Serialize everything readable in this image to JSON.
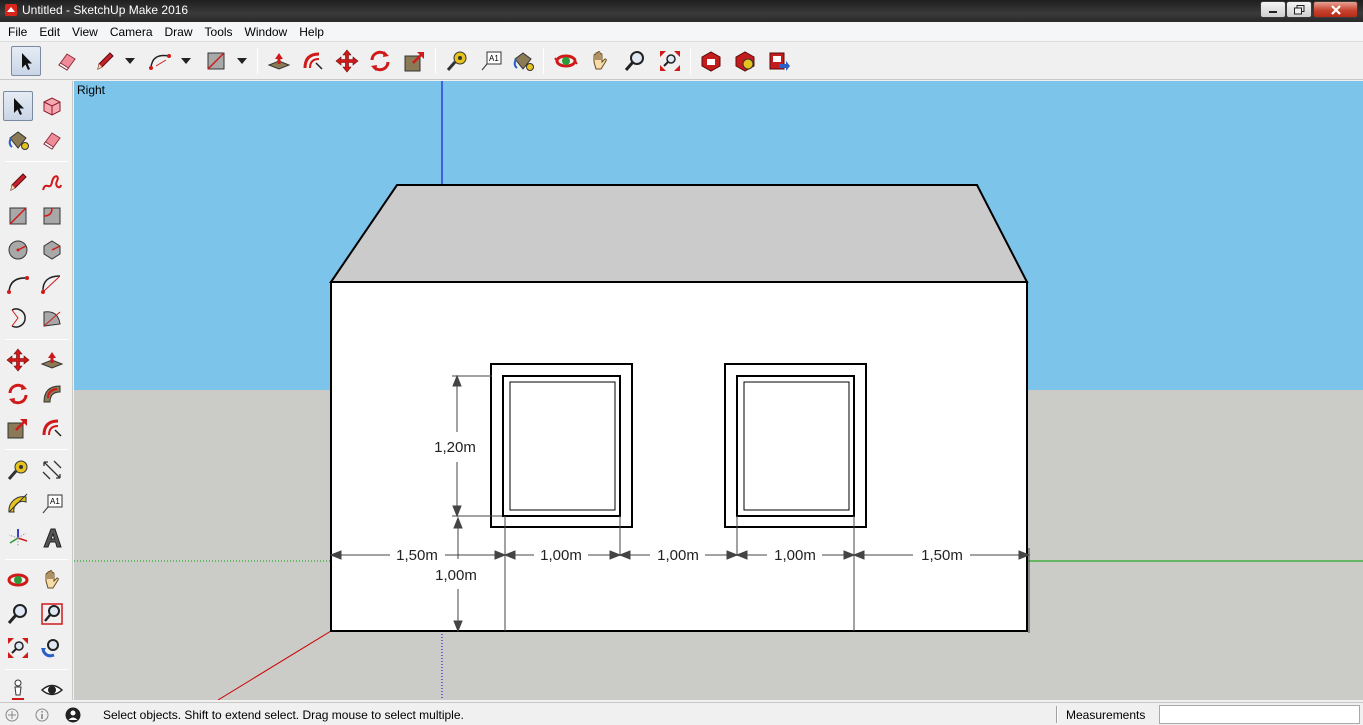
{
  "window": {
    "title": "Untitled - SketchUp Make 2016"
  },
  "menu": {
    "items": [
      "File",
      "Edit",
      "View",
      "Camera",
      "Draw",
      "Tools",
      "Window",
      "Help"
    ]
  },
  "toolbar": {
    "tools": [
      {
        "name": "select-tool",
        "icon": "arrow-icon"
      },
      {
        "name": "eraser-tool",
        "icon": "eraser-icon"
      },
      {
        "name": "line-tool",
        "icon": "pencil-icon"
      },
      {
        "name": "arc-tool",
        "icon": "arc-icon"
      },
      {
        "name": "rectangle-tool",
        "icon": "rectangle-icon"
      },
      {
        "name": "push-pull-tool",
        "icon": "push-pull-icon"
      },
      {
        "name": "offset-tool",
        "icon": "offset-icon"
      },
      {
        "name": "move-tool",
        "icon": "move-icon"
      },
      {
        "name": "rotate-tool",
        "icon": "rotate-icon"
      },
      {
        "name": "scale-tool",
        "icon": "scale-icon"
      },
      {
        "name": "tape-measure-tool",
        "icon": "tape-measure-icon"
      },
      {
        "name": "text-tool",
        "icon": "text-icon"
      },
      {
        "name": "paint-bucket-tool",
        "icon": "paint-bucket-icon"
      },
      {
        "name": "orbit-tool",
        "icon": "orbit-icon"
      },
      {
        "name": "pan-tool",
        "icon": "hand-icon"
      },
      {
        "name": "zoom-tool",
        "icon": "magnifier-icon"
      },
      {
        "name": "zoom-extents-tool",
        "icon": "zoom-extents-icon"
      },
      {
        "name": "warehouse-tool",
        "icon": "warehouse-icon"
      },
      {
        "name": "extension-warehouse-tool",
        "icon": "extension-icon"
      },
      {
        "name": "share-model-tool",
        "icon": "share-icon"
      }
    ]
  },
  "viewport": {
    "label": "Right",
    "dimensions": {
      "window_height": "1,20m",
      "sill_height": "1,00m",
      "left_margin": "1,50m",
      "window1_width": "1,00m",
      "gap": "1,00m",
      "window2_width": "1,00m",
      "right_margin": "1,50m"
    },
    "colors": {
      "sky": "#7cc4ea",
      "ground": "#cbcbc8",
      "wall": "#ffffff",
      "roof": "#cbcbcb",
      "edges": "#000000",
      "axis_red": "#cc0000",
      "axis_green": "#00a000",
      "axis_blue": "#0000cc"
    }
  },
  "statusbar": {
    "message": "Select objects. Shift to extend select. Drag mouse to select multiple.",
    "measurements_label": "Measurements",
    "measurements_value": ""
  }
}
